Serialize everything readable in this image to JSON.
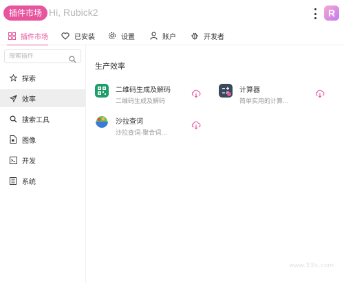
{
  "header": {
    "brand": "插件市场",
    "greeting": "Hi, Rubick2",
    "logo_letter": "R"
  },
  "tabs": [
    {
      "label": "插件市场",
      "icon": "grid-icon",
      "active": true
    },
    {
      "label": "已安装",
      "icon": "heart-icon"
    },
    {
      "label": "设置",
      "icon": "gear-icon"
    },
    {
      "label": "账户",
      "icon": "user-icon"
    },
    {
      "label": "开发者",
      "icon": "bug-icon"
    }
  ],
  "sidebar": {
    "search_placeholder": "搜索插件",
    "items": [
      {
        "label": "探索",
        "icon": "star-icon"
      },
      {
        "label": "效率",
        "icon": "send-icon",
        "active": true
      },
      {
        "label": "搜索工具",
        "icon": "search-icon"
      },
      {
        "label": "图像",
        "icon": "file-image-icon"
      },
      {
        "label": "开发",
        "icon": "code-icon"
      },
      {
        "label": "系统",
        "icon": "list-icon"
      }
    ]
  },
  "main": {
    "section_title": "生产效率",
    "plugins": [
      {
        "name": "二维码生成及解码",
        "desc": "二维码生成及解码",
        "icon": "qrcode-icon",
        "color": "#1e9c6a"
      },
      {
        "name": "计算器",
        "desc": "简单实用的计算...",
        "icon": "calculator-icon",
        "color": "#3a4a5c"
      },
      {
        "name": "沙拉查词",
        "desc": "沙拉查词-聚合词...",
        "icon": "salad-icon",
        "color": "#f4b84a"
      }
    ]
  },
  "colors": {
    "accent": "#e6559e",
    "download": "#e6559e"
  },
  "watermark": "www.33lc.com"
}
